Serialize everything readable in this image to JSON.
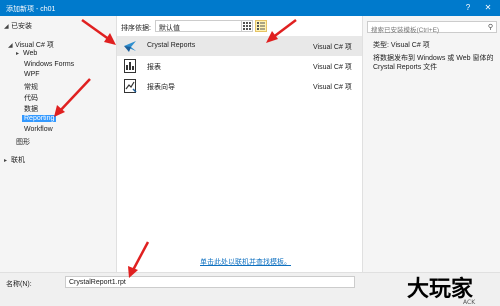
{
  "window": {
    "title": "添加新项 - ch01",
    "help_label": "?",
    "close_label": "✕"
  },
  "sidebar": {
    "installed_label": "已安装",
    "items": [
      {
        "label": "Visual C# 项",
        "expanded": true
      },
      {
        "label": "Web"
      },
      {
        "label": "Windows Forms"
      },
      {
        "label": "WPF"
      },
      {
        "label": "常规"
      },
      {
        "label": "代码"
      },
      {
        "label": "数据"
      },
      {
        "label": "Reporting",
        "selected": true
      },
      {
        "label": "Workflow"
      },
      {
        "label": "图形"
      },
      {
        "label": "联机"
      }
    ]
  },
  "toolbar": {
    "sort_label": "排序依据:",
    "sort_value": "默认值"
  },
  "templates": [
    {
      "name": "Crystal Reports",
      "type": "Visual C# 项",
      "icon": "crystal-reports-icon",
      "selected": true
    },
    {
      "name": "报表",
      "type": "Visual C# 项",
      "icon": "report-icon"
    },
    {
      "name": "报表向导",
      "type": "Visual C# 项",
      "icon": "report-wizard-icon"
    }
  ],
  "online_link": "单击此处以联机并查找模板。",
  "search": {
    "placeholder": "搜索已安装模板(Ctrl+E)"
  },
  "details": {
    "type_label": "类型:",
    "type_value": "Visual C# 项",
    "description": "将数据发布到 Windows 或 Web 窗体的 Crystal Reports 文件"
  },
  "name_field": {
    "label": "名称(N):",
    "value": "CrystalReport1.rpt"
  },
  "watermark": {
    "text": "大玩家",
    "sub": "ACK"
  },
  "colors": {
    "titlebar": "#007acc",
    "selection": "#3399ff",
    "annotation_arrow": "#e02020"
  }
}
